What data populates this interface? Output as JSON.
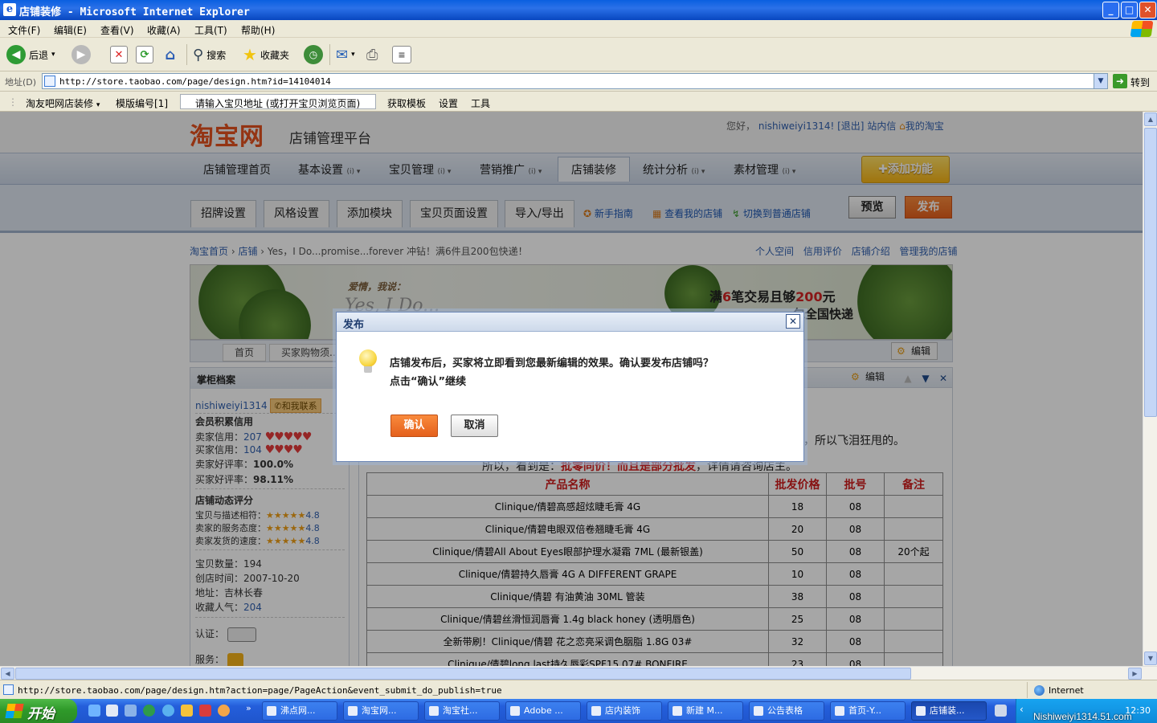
{
  "window": {
    "title": "店铺装修 - Microsoft Internet Explorer",
    "min": "_",
    "max": "□",
    "close": "✕"
  },
  "menu": [
    "文件(F)",
    "编辑(E)",
    "查看(V)",
    "收藏(A)",
    "工具(T)",
    "帮助(H)"
  ],
  "toolbar": {
    "back": "后退",
    "search": "搜索",
    "favorites": "收藏夹"
  },
  "address": {
    "label": "地址(D)",
    "url": "http://store.taobao.com/page/design.htm?id=14104014",
    "go": "转到"
  },
  "links": {
    "plugin": "淘友吧网店装修",
    "template": "模版编号[1]",
    "input_placeholder": "请输入宝贝地址 (或打开宝贝浏览页面)",
    "get_template": "获取模板",
    "settings": "设置",
    "tools": "工具"
  },
  "header": {
    "logo": "淘宝网",
    "logo_sub": "店铺管理平台",
    "greeting": "您好，",
    "username": "nishiweiyi1314!",
    "logout": "[退出]",
    "messages": "站内信",
    "my_taobao": "我的淘宝"
  },
  "nav": [
    {
      "label": "店铺管理首页",
      "dd": ""
    },
    {
      "label": "基本设置",
      "dd": "(i) ▾"
    },
    {
      "label": "宝贝管理",
      "dd": "(i) ▾"
    },
    {
      "label": "营销推广",
      "dd": "(i) ▾"
    },
    {
      "label": "店铺装修",
      "dd": ""
    },
    {
      "label": "统计分析",
      "dd": "(i) ▾"
    },
    {
      "label": "素材管理",
      "dd": "(i) ▾"
    }
  ],
  "add_function": "添加功能",
  "subtabs": [
    "招牌设置",
    "风格设置",
    "添加模块",
    "宝贝页面设置",
    "导入/导出"
  ],
  "sublinks": [
    "新手指南",
    "查看我的店铺",
    "切换到普通店铺"
  ],
  "preview": "预览",
  "publish": "发布",
  "breadcrumb": {
    "home": "淘宝首页",
    "shop": "店铺",
    "current": "Yes，I Do...promise...forever 冲钻！满6件且200包快递！"
  },
  "right_links": [
    "个人空间",
    "信用评价",
    "店铺介绍",
    "管理我的店铺"
  ],
  "banner": {
    "line1": "爱情，我说：",
    "line2": "Yes, I Do...",
    "promo1_a": "满",
    "promo1_b": "6",
    "promo1_c": "笔交易且够",
    "promo1_d": "200",
    "promo1_e": "元",
    "promo2": "包全国快递"
  },
  "store_tabs": [
    "首页",
    "买家购物须..."
  ],
  "edit": "编辑",
  "sidebar": {
    "title": "掌柜档案",
    "user": "nishiweiyi1314",
    "contact": "和我联系",
    "credit_title": "会员积累信用",
    "seller_credit_label": "卖家信用：",
    "seller_credit": "207",
    "buyer_credit_label": "买家信用：",
    "buyer_credit": "104",
    "seller_rate_label": "卖家好评率：",
    "seller_rate": "100.0%",
    "buyer_rate_label": "买家好评率：",
    "buyer_rate": "98.11%",
    "dyn_title": "店铺动态评分",
    "desc_label": "宝贝与描述相符：",
    "desc_score": "4.8",
    "service_label": "卖家的服务态度：",
    "service_score": "4.8",
    "ship_label": "卖家发货的速度：",
    "ship_score": "4.8",
    "items_label": "宝贝数量：",
    "items": "194",
    "created_label": "创店时间：",
    "created": "2007-10-20",
    "addr_label": "地址：",
    "addr": "吉林长春",
    "fav_label": "收藏人气：",
    "fav": "204",
    "cert_label": "认证：",
    "service2_label": "服务："
  },
  "main": {
    "text1": "，所以飞泪狂甩的。",
    "text2_a": "所以，看到是：",
    "text2_b": "批零同价！而且是部分批发",
    "text2_c": "，详情请咨询店主。"
  },
  "table": {
    "headers": [
      "产品名称",
      "批发价格",
      "批号",
      "备注"
    ],
    "rows": [
      [
        "Clinique/倩碧高感超炫睫毛膏 4G",
        "18",
        "08",
        ""
      ],
      [
        "Clinique/倩碧电眼双倍卷翘睫毛膏 4G",
        "20",
        "08",
        ""
      ],
      [
        "Clinique/倩碧All About Eyes眼部护理水凝霜 7ML (最新银盖)",
        "50",
        "08",
        "20个起"
      ],
      [
        "Clinique/倩碧持久唇膏 4G A DIFFERENT GRAPE",
        "10",
        "08",
        ""
      ],
      [
        "Clinique/倩碧 有油黄油 30ML 管装",
        "38",
        "08",
        ""
      ],
      [
        "Clinique/倩碧丝滑恒润唇膏 1.4g black honey (透明唇色)",
        "25",
        "08",
        ""
      ],
      [
        "全新带刷！Clinique/倩碧 花之恋亮采调色胭脂 1.8G 03#",
        "32",
        "08",
        ""
      ],
      [
        "Clinique/倩碧long last持久唇彩SPF15 07# BONFIRE",
        "23",
        "08",
        ""
      ]
    ]
  },
  "dialog": {
    "title": "发布",
    "close": "✕",
    "message1": "店铺发布后，买家将立即看到您最新编辑的效果。确认要发布店铺吗？",
    "message2": "点击“确认”继续",
    "ok": "确认",
    "cancel": "取消"
  },
  "status": {
    "url": "http://store.taobao.com/page/design.htm?action=page/PageAction&event_submit_do_publish=true",
    "zone": "Internet"
  },
  "taskbar": {
    "start": "开始",
    "tasks": [
      "沸点网...",
      "淘宝网...",
      "淘宝社...",
      "Adobe ...",
      "店内装饰",
      "新建 M...",
      "公告表格",
      "首页-Y...",
      "店铺装..."
    ],
    "clock": "12:30"
  },
  "watermark": "Nishiweiyi1314.51.com"
}
